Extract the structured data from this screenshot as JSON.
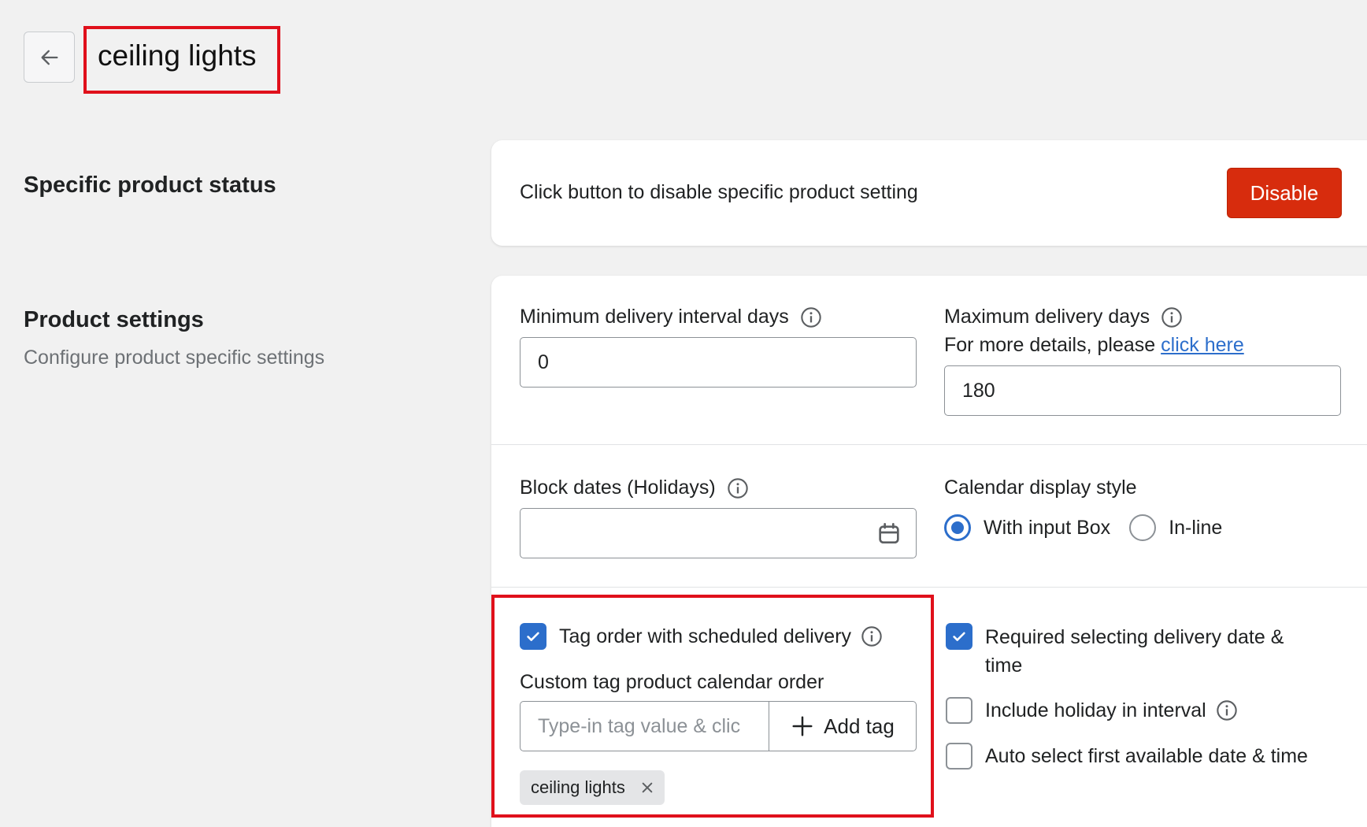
{
  "header": {
    "title": "ceiling lights",
    "back_icon": "arrow-left-icon"
  },
  "status_section": {
    "heading": "Specific product status",
    "description": "Click button to disable specific product setting",
    "disable_label": "Disable"
  },
  "settings_section": {
    "heading": "Product settings",
    "subheading": "Configure product specific settings",
    "min_interval": {
      "label": "Minimum delivery interval days",
      "value": "0"
    },
    "max_days": {
      "label": "Maximum delivery days",
      "details_prefix": "For more details, please",
      "details_link": "click here",
      "value": "180"
    },
    "block_dates": {
      "label": "Block dates (Holidays)",
      "value": ""
    },
    "calendar_style": {
      "label": "Calendar display style",
      "options": [
        "With input Box",
        "In-line"
      ],
      "selected": "With input Box"
    },
    "tag_order": {
      "label": "Tag order with scheduled delivery",
      "checked": true,
      "custom_label": "Custom tag product calendar order",
      "placeholder": "Type-in tag value & clic",
      "add_label": "Add tag",
      "tags": [
        "ceiling lights"
      ]
    },
    "options": [
      {
        "label": "Required selecting delivery date &",
        "label_line2": "time",
        "checked": true
      },
      {
        "label": "Include holiday in interval",
        "checked": false
      },
      {
        "label": "Auto select first available date & time",
        "checked": false
      }
    ]
  },
  "colors": {
    "primary": "#2c6ecb",
    "critical": "#d72c0d",
    "highlight": "#e0101b",
    "background": "#f1f1f1"
  }
}
